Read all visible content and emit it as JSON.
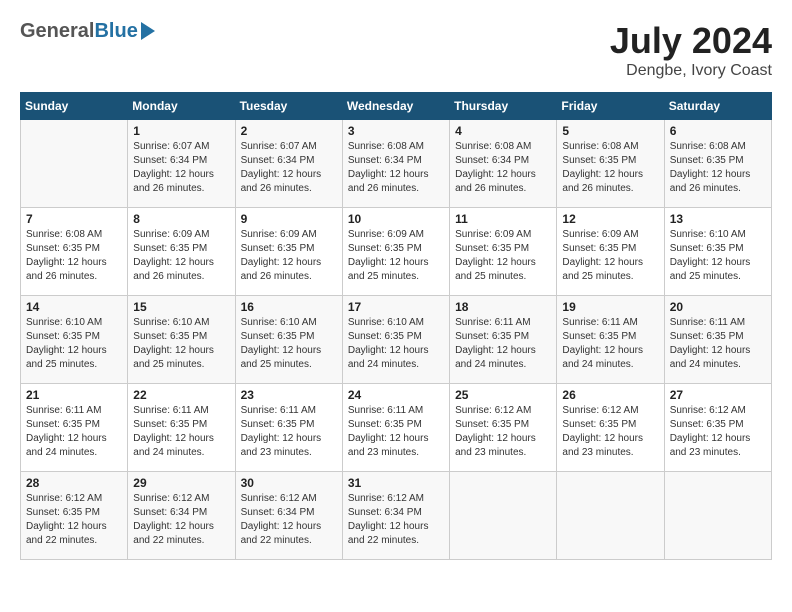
{
  "header": {
    "logo_general": "General",
    "logo_blue": "Blue",
    "month_year": "July 2024",
    "location": "Dengbe, Ivory Coast"
  },
  "days_of_week": [
    "Sunday",
    "Monday",
    "Tuesday",
    "Wednesday",
    "Thursday",
    "Friday",
    "Saturday"
  ],
  "weeks": [
    {
      "days": [
        {
          "number": "",
          "info": ""
        },
        {
          "number": "1",
          "info": "Sunrise: 6:07 AM\nSunset: 6:34 PM\nDaylight: 12 hours\nand 26 minutes."
        },
        {
          "number": "2",
          "info": "Sunrise: 6:07 AM\nSunset: 6:34 PM\nDaylight: 12 hours\nand 26 minutes."
        },
        {
          "number": "3",
          "info": "Sunrise: 6:08 AM\nSunset: 6:34 PM\nDaylight: 12 hours\nand 26 minutes."
        },
        {
          "number": "4",
          "info": "Sunrise: 6:08 AM\nSunset: 6:34 PM\nDaylight: 12 hours\nand 26 minutes."
        },
        {
          "number": "5",
          "info": "Sunrise: 6:08 AM\nSunset: 6:35 PM\nDaylight: 12 hours\nand 26 minutes."
        },
        {
          "number": "6",
          "info": "Sunrise: 6:08 AM\nSunset: 6:35 PM\nDaylight: 12 hours\nand 26 minutes."
        }
      ]
    },
    {
      "days": [
        {
          "number": "7",
          "info": "Sunrise: 6:08 AM\nSunset: 6:35 PM\nDaylight: 12 hours\nand 26 minutes."
        },
        {
          "number": "8",
          "info": "Sunrise: 6:09 AM\nSunset: 6:35 PM\nDaylight: 12 hours\nand 26 minutes."
        },
        {
          "number": "9",
          "info": "Sunrise: 6:09 AM\nSunset: 6:35 PM\nDaylight: 12 hours\nand 26 minutes."
        },
        {
          "number": "10",
          "info": "Sunrise: 6:09 AM\nSunset: 6:35 PM\nDaylight: 12 hours\nand 25 minutes."
        },
        {
          "number": "11",
          "info": "Sunrise: 6:09 AM\nSunset: 6:35 PM\nDaylight: 12 hours\nand 25 minutes."
        },
        {
          "number": "12",
          "info": "Sunrise: 6:09 AM\nSunset: 6:35 PM\nDaylight: 12 hours\nand 25 minutes."
        },
        {
          "number": "13",
          "info": "Sunrise: 6:10 AM\nSunset: 6:35 PM\nDaylight: 12 hours\nand 25 minutes."
        }
      ]
    },
    {
      "days": [
        {
          "number": "14",
          "info": "Sunrise: 6:10 AM\nSunset: 6:35 PM\nDaylight: 12 hours\nand 25 minutes."
        },
        {
          "number": "15",
          "info": "Sunrise: 6:10 AM\nSunset: 6:35 PM\nDaylight: 12 hours\nand 25 minutes."
        },
        {
          "number": "16",
          "info": "Sunrise: 6:10 AM\nSunset: 6:35 PM\nDaylight: 12 hours\nand 25 minutes."
        },
        {
          "number": "17",
          "info": "Sunrise: 6:10 AM\nSunset: 6:35 PM\nDaylight: 12 hours\nand 24 minutes."
        },
        {
          "number": "18",
          "info": "Sunrise: 6:11 AM\nSunset: 6:35 PM\nDaylight: 12 hours\nand 24 minutes."
        },
        {
          "number": "19",
          "info": "Sunrise: 6:11 AM\nSunset: 6:35 PM\nDaylight: 12 hours\nand 24 minutes."
        },
        {
          "number": "20",
          "info": "Sunrise: 6:11 AM\nSunset: 6:35 PM\nDaylight: 12 hours\nand 24 minutes."
        }
      ]
    },
    {
      "days": [
        {
          "number": "21",
          "info": "Sunrise: 6:11 AM\nSunset: 6:35 PM\nDaylight: 12 hours\nand 24 minutes."
        },
        {
          "number": "22",
          "info": "Sunrise: 6:11 AM\nSunset: 6:35 PM\nDaylight: 12 hours\nand 24 minutes."
        },
        {
          "number": "23",
          "info": "Sunrise: 6:11 AM\nSunset: 6:35 PM\nDaylight: 12 hours\nand 23 minutes."
        },
        {
          "number": "24",
          "info": "Sunrise: 6:11 AM\nSunset: 6:35 PM\nDaylight: 12 hours\nand 23 minutes."
        },
        {
          "number": "25",
          "info": "Sunrise: 6:12 AM\nSunset: 6:35 PM\nDaylight: 12 hours\nand 23 minutes."
        },
        {
          "number": "26",
          "info": "Sunrise: 6:12 AM\nSunset: 6:35 PM\nDaylight: 12 hours\nand 23 minutes."
        },
        {
          "number": "27",
          "info": "Sunrise: 6:12 AM\nSunset: 6:35 PM\nDaylight: 12 hours\nand 23 minutes."
        }
      ]
    },
    {
      "days": [
        {
          "number": "28",
          "info": "Sunrise: 6:12 AM\nSunset: 6:35 PM\nDaylight: 12 hours\nand 22 minutes."
        },
        {
          "number": "29",
          "info": "Sunrise: 6:12 AM\nSunset: 6:34 PM\nDaylight: 12 hours\nand 22 minutes."
        },
        {
          "number": "30",
          "info": "Sunrise: 6:12 AM\nSunset: 6:34 PM\nDaylight: 12 hours\nand 22 minutes."
        },
        {
          "number": "31",
          "info": "Sunrise: 6:12 AM\nSunset: 6:34 PM\nDaylight: 12 hours\nand 22 minutes."
        },
        {
          "number": "",
          "info": ""
        },
        {
          "number": "",
          "info": ""
        },
        {
          "number": "",
          "info": ""
        }
      ]
    }
  ]
}
